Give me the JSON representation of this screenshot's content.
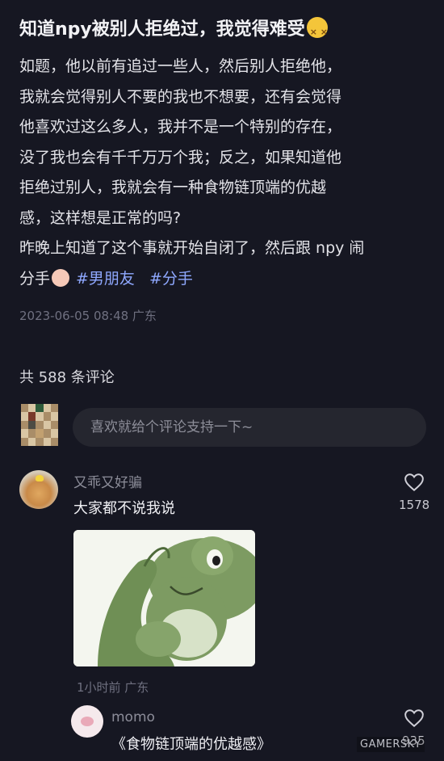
{
  "post": {
    "title": "知道npy被别人拒绝过，我觉得难受",
    "body_lines": [
      "如题，他以前有追过一些人，然后别人拒绝他，",
      "我就会觉得别人不要的我也不想要，还有会觉得",
      "他喜欢过这么多人，我并不是一个特别的存在，",
      "没了我也会有千千万万个我；反之，如果知道他",
      "拒绝过别人，我就会有一种食物链顶端的优越",
      "感，这样想是正常的吗?",
      "昨晚上知道了这个事就开始自闭了，然后跟 npy 闹"
    ],
    "last_line_prefix": "分手",
    "tags": [
      "#男朋友",
      "#分手"
    ],
    "meta": "2023-06-05 08:48 广东"
  },
  "comments_section": {
    "count_label": "共 588 条评论",
    "input_placeholder": "喜欢就给个评论支持一下~"
  },
  "comments": [
    {
      "username": "又乖又好骗",
      "text": "大家都不说我说",
      "likes": "1578",
      "time": "1小时前 广东",
      "image": "frog-thinking-meme"
    },
    {
      "username": "momo",
      "text": "《食物链顶端的优越感》",
      "likes": "935"
    }
  ],
  "watermark": "GAMERSKY",
  "colors": {
    "background": "#161722",
    "tag": "#8fa8ff",
    "muted": "#6f7080"
  },
  "icons": [
    "dizzy-face-emoji",
    "crying-emoji",
    "heart-icon"
  ]
}
